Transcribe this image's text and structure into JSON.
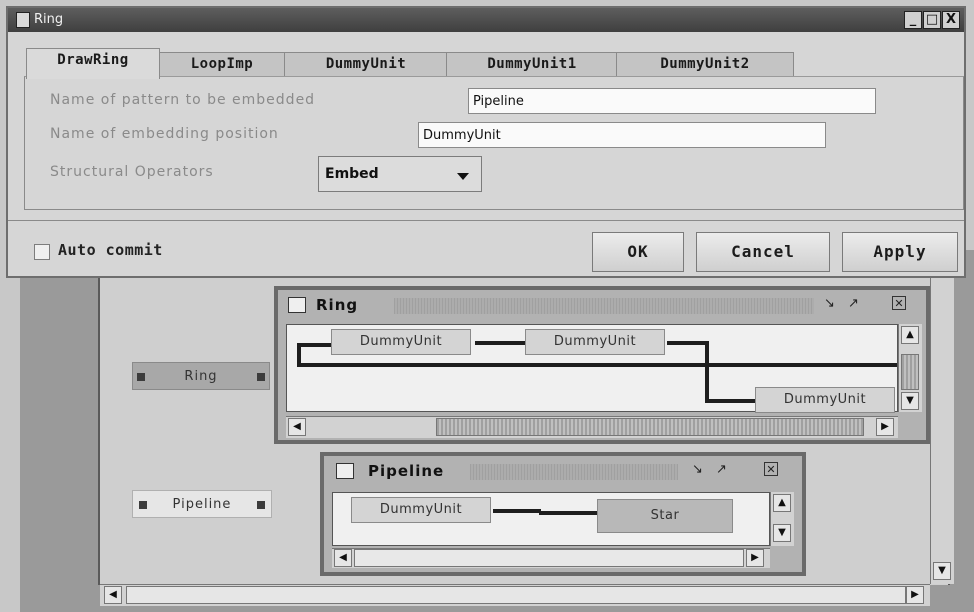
{
  "window": {
    "title": "Ring",
    "controls": {
      "minimize": "_",
      "maximize": "□",
      "close": "X"
    }
  },
  "tabs": [
    "DrawRing",
    "LoopImp",
    "DummyUnit",
    "DummyUnit1",
    "DummyUnit2"
  ],
  "active_tab": "DrawRing",
  "form": {
    "pattern_label": "Name of pattern to be embedded",
    "pattern_value": "Pipeline",
    "position_label": "Name of embedding position",
    "position_value": "DummyUnit",
    "operators_label": "Structural Operators",
    "operators_selected": "Embed"
  },
  "footer": {
    "auto_commit_label": "Auto commit",
    "auto_commit_checked": false,
    "ok_label": "OK",
    "cancel_label": "Cancel",
    "apply_label": "Apply"
  },
  "workspace": {
    "palette_items": [
      "Ring",
      "Pipeline"
    ]
  },
  "ring_frame": {
    "title": "Ring",
    "units": [
      "DummyUnit",
      "DummyUnit",
      "DummyUnit"
    ]
  },
  "pipeline_frame": {
    "title": "Pipeline",
    "units": [
      "DummyUnit",
      "Star"
    ]
  },
  "icons": {
    "frame_icon": "window-icon",
    "iconify": "minimize-icon",
    "maximize": "maximize-icon",
    "close": "close-icon"
  },
  "colors": {
    "titlebar": "#4a4a4a",
    "dialog_bg": "#d6d6d6",
    "frame_border": "#6a6a6a"
  }
}
